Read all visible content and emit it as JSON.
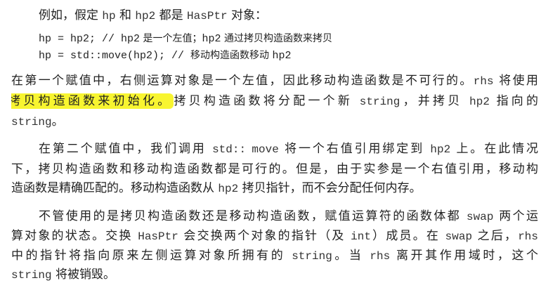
{
  "intro": [
    {
      "t": "例如，假定 "
    },
    {
      "t": "hp",
      "c": 1
    },
    {
      "t": " 和 "
    },
    {
      "t": "hp2",
      "c": 1
    },
    {
      "t": " 都是 "
    },
    {
      "t": "HasPtr",
      "c": 1
    },
    {
      "t": " 对象："
    }
  ],
  "code": [
    [
      {
        "t": "hp = hp2; // ",
        "c": 1
      },
      {
        "t": "hp2",
        "c": 1
      },
      {
        "t": " 是一个左值；",
        "m": 1
      },
      {
        "t": "hp2",
        "c": 1
      },
      {
        "t": " 通过拷贝构造函数来拷贝",
        "m": 1
      }
    ],
    [
      {
        "t": "hp = std::move(hp2); // ",
        "c": 1
      },
      {
        "t": "移动构造函数移动 ",
        "m": 1
      },
      {
        "t": "hp2",
        "c": 1
      }
    ]
  ],
  "paragraphs": [
    {
      "lines": [
        [
          {
            "t": "在第一个赋值中，右侧运算对象是一个左值，因此移动构造函数是不可行的。"
          },
          {
            "t": "rhs",
            "c": 1
          },
          {
            "t": " 将使用"
          }
        ],
        [
          {
            "t": "拷贝构造函数来初始化。",
            "h": 1
          },
          {
            "t": "拷贝构造函数将分配一个新 "
          },
          {
            "t": "string",
            "c": 1
          },
          {
            "t": "，并拷贝 "
          },
          {
            "t": "hp2",
            "c": 1
          },
          {
            "t": " 指向的"
          }
        ],
        [
          {
            "t": "string",
            "c": 1
          },
          {
            "t": "。"
          }
        ]
      ]
    },
    {
      "lines": [
        [
          {
            "t": "在第二个赋值中，我们调用 "
          },
          {
            "t": "std::",
            "c": 1
          },
          {
            "t": " "
          },
          {
            "t": "move",
            "c": 1
          },
          {
            "t": " 将一个右值引用绑定到 "
          },
          {
            "t": "hp2",
            "c": 1
          },
          {
            "t": " 上。在此情况"
          }
        ],
        [
          {
            "t": "下，拷贝构造函数和移动构造函数都是可行的。但是，由于实参是一个右值引用，移动构"
          }
        ],
        [
          {
            "t": "造函数是精确匹配的。移动构造函数从 "
          },
          {
            "t": "hp2",
            "c": 1
          },
          {
            "t": " 拷贝指针，而不会分配任何内存。"
          }
        ]
      ]
    },
    {
      "lines": [
        [
          {
            "t": "不管使用的是拷贝构造函数还是移动构造函数，赋值运算符的函数体都 "
          },
          {
            "t": "swap",
            "c": 1
          },
          {
            "t": " 两个运"
          }
        ],
        [
          {
            "t": "算对象的状态。交换 "
          },
          {
            "t": "HasPtr",
            "c": 1
          },
          {
            "t": " 会交换两个对象的指针（及 "
          },
          {
            "t": "int",
            "c": 1
          },
          {
            "t": "）成员。在 "
          },
          {
            "t": "swap",
            "c": 1
          },
          {
            "t": " 之后，"
          },
          {
            "t": "rhs",
            "c": 1
          }
        ],
        [
          {
            "t": "中的指针将指向原来左侧运算对象所拥有的 "
          },
          {
            "t": "string",
            "c": 1
          },
          {
            "t": "。当 "
          },
          {
            "t": "rhs",
            "c": 1
          },
          {
            "t": " 离开其作用域时，这个"
          }
        ],
        [
          {
            "t": "string",
            "c": 1
          },
          {
            "t": " 将被销毁。"
          }
        ]
      ]
    }
  ],
  "colors": {
    "highlight": "#f8f530"
  }
}
